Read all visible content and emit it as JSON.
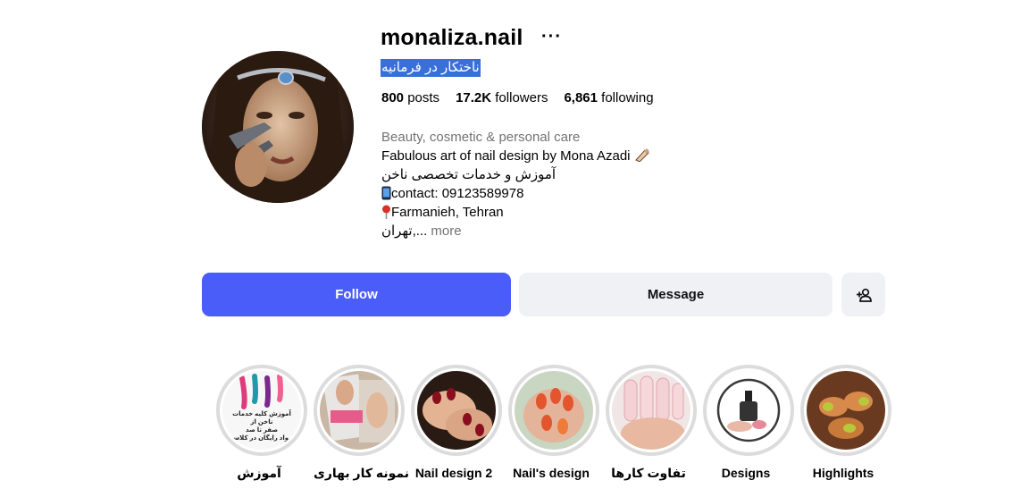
{
  "profile": {
    "username": "monaliza.nail",
    "options_icon": "more-dots-icon",
    "full_name": "ناختکار در فرمانیه",
    "stats": {
      "posts_value": "800",
      "posts_label": "posts",
      "followers_value": "17.2K",
      "followers_label": "followers",
      "following_value": "6,861",
      "following_label": "following"
    },
    "bio": {
      "category": "Beauty, cosmetic & personal care",
      "line1": "Fabulous art of nail design by Mona Azadi",
      "line2": "آموزش و خدمات تخصصی ناخن",
      "line3": "contact: 09123589978",
      "line4": "Farmanieh, Tehran",
      "line5": "تهران,...",
      "more": "more"
    }
  },
  "actions": {
    "follow": "Follow",
    "message": "Message",
    "suggest_icon": "add-person-icon"
  },
  "highlights": [
    {
      "label": "آموزش",
      "promo": [
        "آموزش کلیه خدمات ناخن از",
        "صفر تا صد",
        "مواد رایگان در کلاس"
      ]
    },
    {
      "label": "نمونه کار بهاری"
    },
    {
      "label": "Nail design 2"
    },
    {
      "label": "Nail's design"
    },
    {
      "label": "تفاوت کارها"
    },
    {
      "label": "Designs"
    },
    {
      "label": "Highlights"
    }
  ],
  "colors": {
    "follow_bg": "#4a5df9",
    "secondary_bg": "#eff1f5",
    "selection_bg": "#3b6fd8",
    "muted_text": "#737373"
  }
}
